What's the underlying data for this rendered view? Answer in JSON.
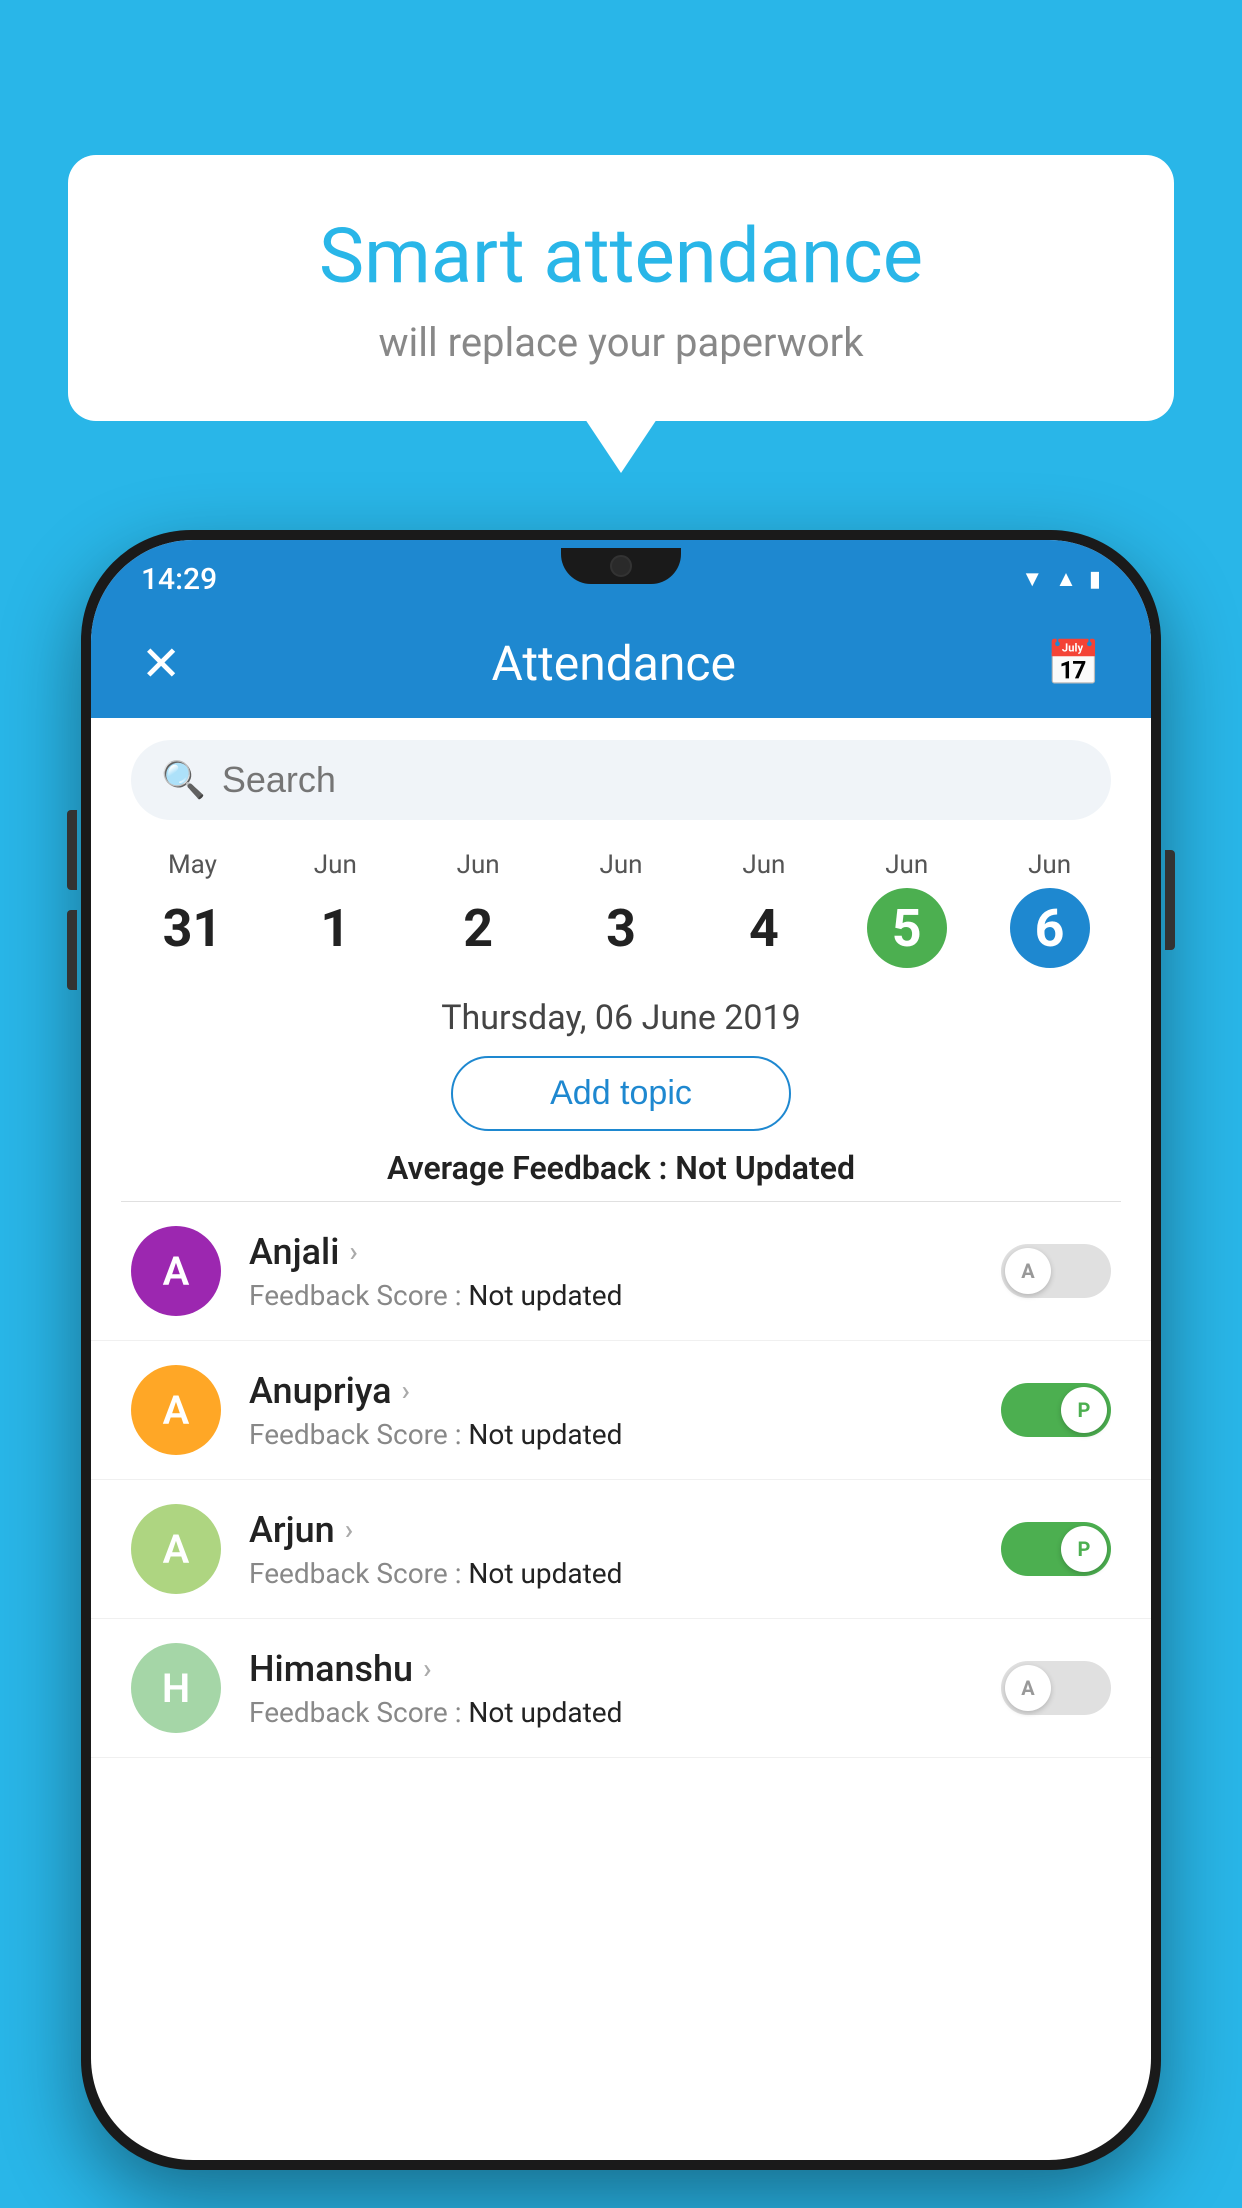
{
  "app": {
    "background_color": "#29b6e8"
  },
  "bubble": {
    "title": "Smart attendance",
    "subtitle": "will replace your paperwork"
  },
  "status_bar": {
    "time": "14:29",
    "wifi_icon": "▲",
    "signal_icon": "▲",
    "battery_icon": "▮"
  },
  "header": {
    "title": "Attendance",
    "close_label": "✕",
    "calendar_label": "📅"
  },
  "search": {
    "placeholder": "Search"
  },
  "dates": [
    {
      "month": "May",
      "day": "31",
      "state": "normal"
    },
    {
      "month": "Jun",
      "day": "1",
      "state": "normal"
    },
    {
      "month": "Jun",
      "day": "2",
      "state": "normal"
    },
    {
      "month": "Jun",
      "day": "3",
      "state": "normal"
    },
    {
      "month": "Jun",
      "day": "4",
      "state": "normal"
    },
    {
      "month": "Jun",
      "day": "5",
      "state": "today"
    },
    {
      "month": "Jun",
      "day": "6",
      "state": "selected"
    }
  ],
  "selected_date_label": "Thursday, 06 June 2019",
  "add_topic_label": "Add topic",
  "avg_feedback_label": "Average Feedback :",
  "avg_feedback_value": "Not Updated",
  "students": [
    {
      "name": "Anjali",
      "initial": "A",
      "avatar_color": "#9c27b0",
      "feedback_label": "Feedback Score :",
      "feedback_value": "Not updated",
      "attendance": "absent",
      "toggle_label": "A"
    },
    {
      "name": "Anupriya",
      "initial": "A",
      "avatar_color": "#ffa726",
      "feedback_label": "Feedback Score :",
      "feedback_value": "Not updated",
      "attendance": "present",
      "toggle_label": "P"
    },
    {
      "name": "Arjun",
      "initial": "A",
      "avatar_color": "#aed581",
      "feedback_label": "Feedback Score :",
      "feedback_value": "Not updated",
      "attendance": "present",
      "toggle_label": "P"
    },
    {
      "name": "Himanshu",
      "initial": "H",
      "avatar_color": "#a5d6a7",
      "feedback_label": "Feedback Score :",
      "feedback_value": "Not updated",
      "attendance": "absent",
      "toggle_label": "A"
    }
  ]
}
